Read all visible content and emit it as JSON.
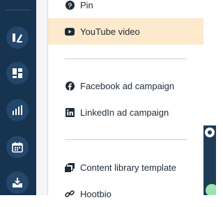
{
  "sidebar": {
    "items": [
      {
        "icon": "create-post-icon"
      },
      {
        "icon": "dashboard-icon"
      },
      {
        "icon": "analytics-icon"
      },
      {
        "icon": "calendar-icon"
      },
      {
        "icon": "inbox-icon"
      }
    ]
  },
  "menu": {
    "items": [
      {
        "label": "Pin",
        "icon": "pinterest-icon"
      },
      {
        "label": "YouTube video",
        "icon": "youtube-icon",
        "highlighted": true
      },
      {
        "label": "Facebook ad campaign",
        "icon": "facebook-icon"
      },
      {
        "label": "LinkedIn ad campaign",
        "icon": "linkedin-icon"
      },
      {
        "label": "Content library template",
        "icon": "content-library-icon"
      },
      {
        "label": "Hootbio",
        "icon": "link-icon"
      }
    ]
  },
  "colors": {
    "sidebar_bg": "#163350",
    "highlight_bg": "#fde9cc",
    "text": "#1f2b36"
  }
}
